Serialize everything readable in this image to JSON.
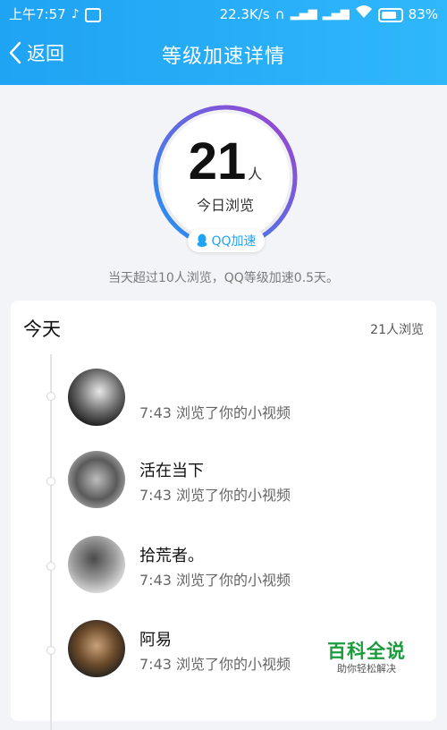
{
  "statusbar": {
    "time": "上午7:57",
    "net_speed": "22.3K/s",
    "battery_pct": "83%"
  },
  "header": {
    "back_label": "返回",
    "title": "等级加速详情"
  },
  "ring": {
    "count": "21",
    "unit": "人",
    "label": "今日浏览",
    "badge": "QQ加速"
  },
  "summary": "当天超过10人浏览，QQ等级加速0.5天。",
  "card": {
    "heading": "今天",
    "count_label": "21人浏览",
    "entries": [
      {
        "name": "",
        "desc": "7:43 浏览了你的小视频"
      },
      {
        "name": "活在当下",
        "desc": "7:43 浏览了你的小视频"
      },
      {
        "name": "拾荒者。",
        "desc": "7:43 浏览了你的小视频"
      },
      {
        "name": "阿易",
        "desc": "7:43 浏览了你的小视频"
      }
    ]
  },
  "watermark": {
    "main": "百科全说",
    "sub": "助你轻松解决"
  },
  "colors": {
    "accent": "#1fa3f3",
    "ring_start": "#2196f3",
    "ring_end": "#a040d0",
    "watermark": "#1a9c3c"
  }
}
